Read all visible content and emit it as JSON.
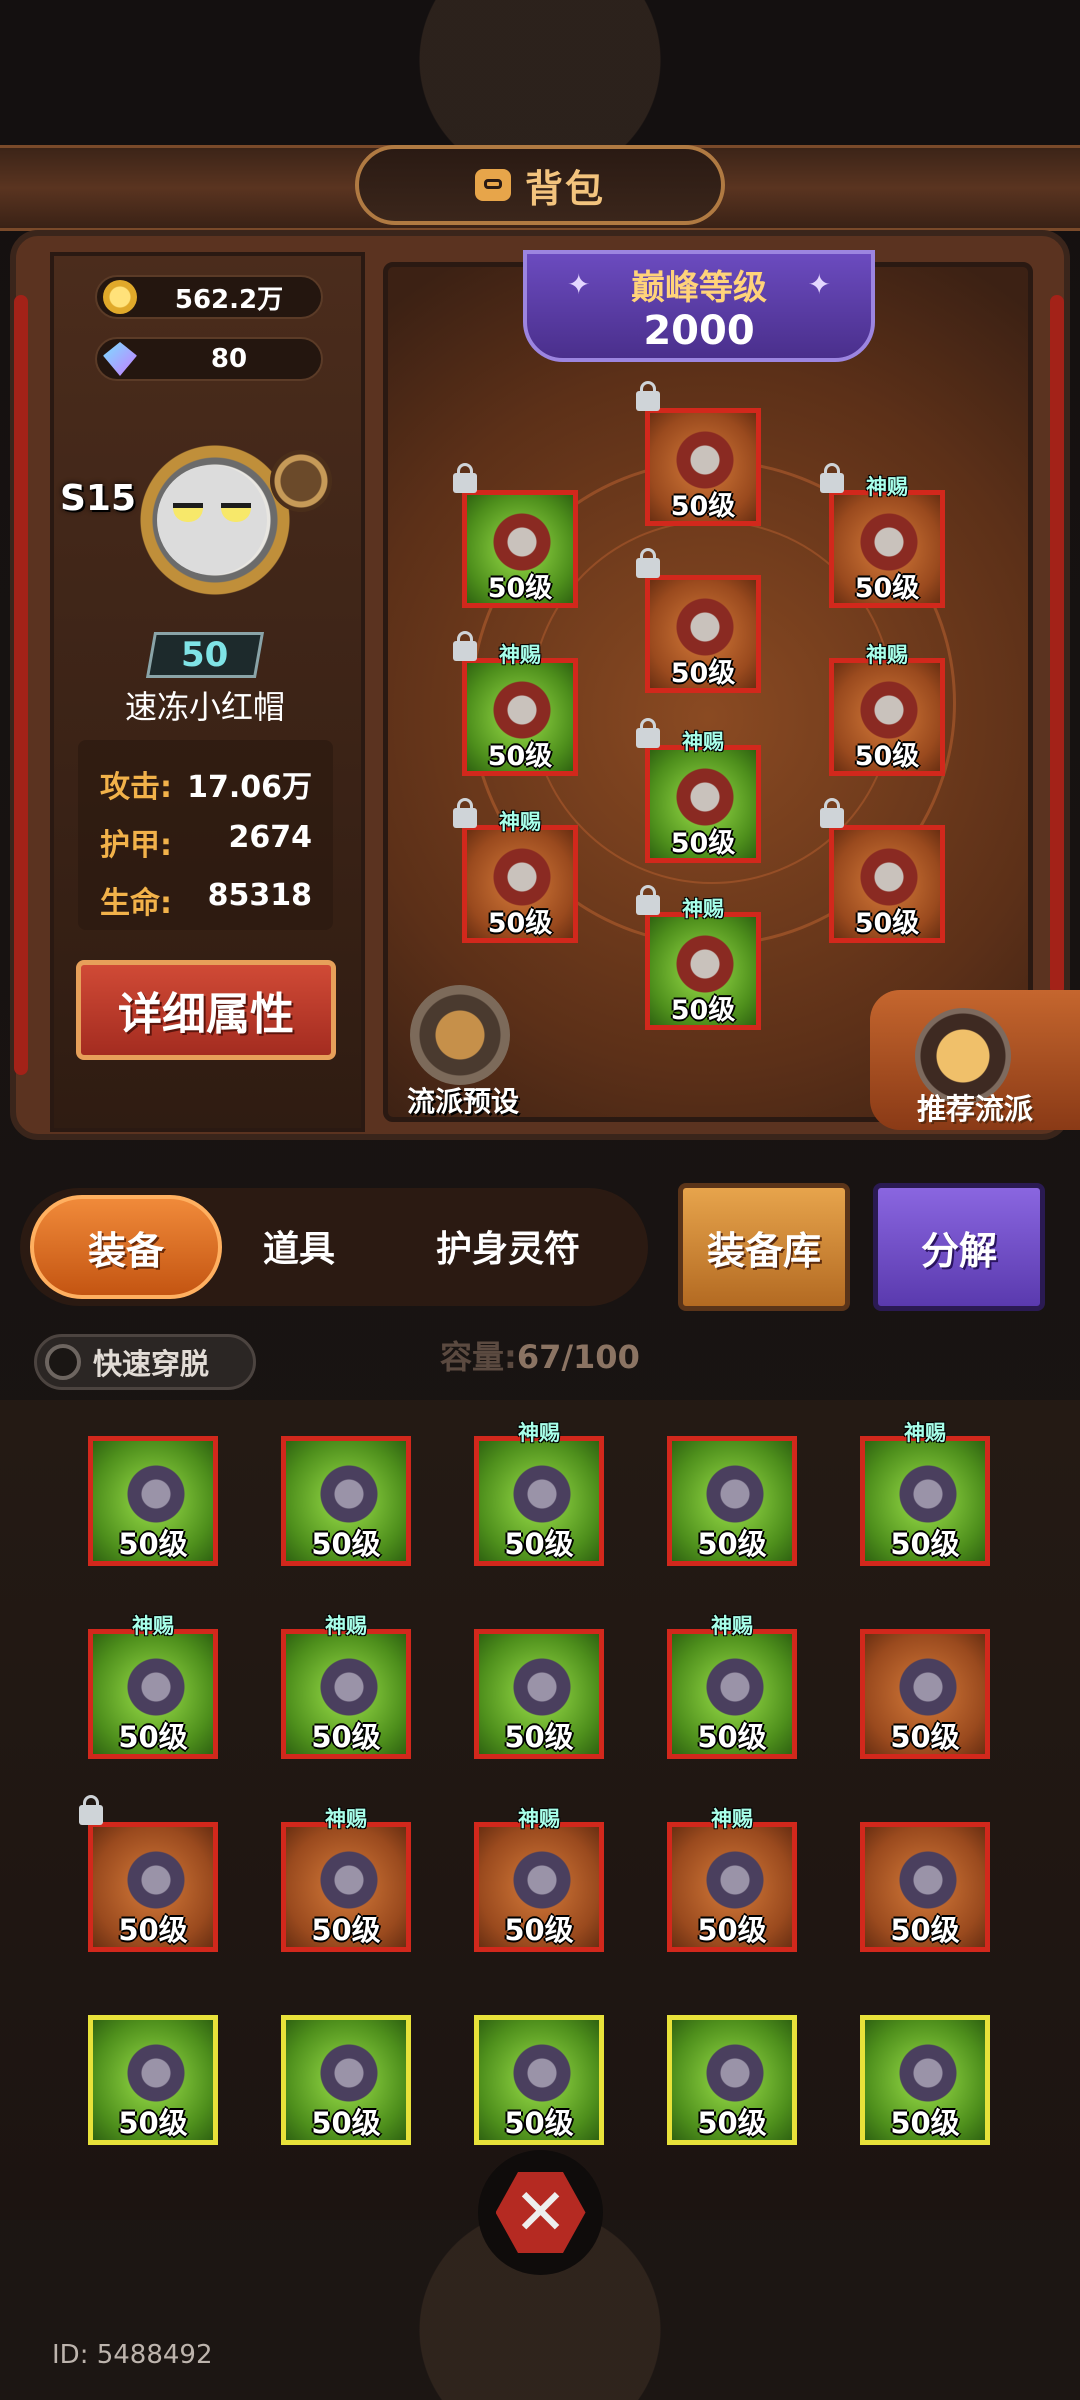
{
  "header": {
    "title": "背包"
  },
  "currencies": [
    {
      "icon": "gold-coin-icon",
      "value": "562.2万"
    },
    {
      "icon": "gem-icon",
      "value": "80"
    }
  ],
  "hero": {
    "season": "S15",
    "level": "50",
    "name": "速冻小红帽",
    "stats": [
      {
        "label": "攻击:",
        "value": "17.06万"
      },
      {
        "label": "护甲:",
        "value": "2674"
      },
      {
        "label": "生命:",
        "value": "85318"
      }
    ],
    "detail_button": "详细属性"
  },
  "peak": {
    "label": "巅峰等级",
    "value": "2000"
  },
  "equipped": [
    {
      "level": "50级",
      "locked": true,
      "tag": "",
      "color": "orange",
      "icon": "helmet-icon"
    },
    {
      "level": "50级",
      "locked": true,
      "tag": "",
      "color": "green",
      "icon": "shoulder-armor-icon"
    },
    {
      "level": "50级",
      "locked": true,
      "tag": "神赐",
      "color": "orange",
      "icon": "necklace-icon"
    },
    {
      "level": "50级",
      "locked": true,
      "tag": "",
      "color": "orange",
      "icon": "chest-armor-icon"
    },
    {
      "level": "50级",
      "locked": true,
      "tag": "神赐",
      "color": "green",
      "icon": "gauntlet-icon"
    },
    {
      "level": "50级",
      "locked": false,
      "tag": "神赐",
      "color": "orange",
      "icon": "ring-icon"
    },
    {
      "level": "50级",
      "locked": true,
      "tag": "神赐",
      "color": "green",
      "icon": "pants-icon"
    },
    {
      "level": "50级",
      "locked": true,
      "tag": "神赐",
      "color": "orange",
      "icon": "cape-icon"
    },
    {
      "level": "50级",
      "locked": true,
      "tag": "",
      "color": "orange",
      "icon": "book-icon"
    },
    {
      "level": "50级",
      "locked": true,
      "tag": "神赐",
      "color": "green",
      "icon": "boots-icon"
    }
  ],
  "preset": {
    "label": "流派预设"
  },
  "recommend": {
    "label": "推荐流派"
  },
  "tabs": {
    "equip": "装备",
    "items": "道具",
    "charm": "护身灵符"
  },
  "buttons": {
    "vault": "装备库",
    "decompose": "分解"
  },
  "quick_toggle": "快速穿脱",
  "capacity": {
    "label": "容量:",
    "value": "67/100"
  },
  "inventory": [
    {
      "level": "50级",
      "tag": "",
      "color": "green",
      "locked": false,
      "icon": "robe-icon"
    },
    {
      "level": "50级",
      "tag": "",
      "color": "green",
      "locked": false,
      "icon": "robe-icon"
    },
    {
      "level": "50级",
      "tag": "神赐",
      "color": "green",
      "locked": false,
      "icon": "bracer-icon"
    },
    {
      "level": "50级",
      "tag": "",
      "color": "green",
      "locked": false,
      "icon": "hat-icon"
    },
    {
      "level": "50级",
      "tag": "神赐",
      "color": "green",
      "locked": false,
      "icon": "gauntlet-icon"
    },
    {
      "level": "50级",
      "tag": "神赐",
      "color": "green",
      "locked": false,
      "icon": "pants-icon"
    },
    {
      "level": "50级",
      "tag": "神赐",
      "color": "green",
      "locked": false,
      "icon": "boots-icon"
    },
    {
      "level": "50级",
      "tag": "",
      "color": "green",
      "locked": false,
      "icon": "boots-icon"
    },
    {
      "level": "50级",
      "tag": "神赐",
      "color": "green",
      "locked": false,
      "icon": "helmet-icon"
    },
    {
      "level": "50级",
      "tag": "",
      "color": "orange",
      "locked": false,
      "icon": "claw-icon"
    },
    {
      "level": "50级",
      "tag": "",
      "color": "orange",
      "locked": true,
      "icon": "cape-icon"
    },
    {
      "level": "50级",
      "tag": "神赐",
      "color": "orange",
      "locked": false,
      "icon": "bracer-icon"
    },
    {
      "level": "50级",
      "tag": "神赐",
      "color": "orange",
      "locked": false,
      "icon": "pants-icon"
    },
    {
      "level": "50级",
      "tag": "神赐",
      "color": "orange",
      "locked": false,
      "icon": "pants-icon"
    },
    {
      "level": "50级",
      "tag": "",
      "color": "orange",
      "locked": false,
      "icon": "pants-icon"
    },
    {
      "level": "50级",
      "tag": "",
      "color": "green",
      "locked": false,
      "icon": "chest-armor-icon",
      "yellow": true
    },
    {
      "level": "50级",
      "tag": "",
      "color": "green",
      "locked": false,
      "icon": "hat-icon",
      "yellow": true
    },
    {
      "level": "50级",
      "tag": "",
      "color": "green",
      "locked": false,
      "icon": "hat-icon",
      "yellow": true
    },
    {
      "level": "50级",
      "tag": "",
      "color": "green",
      "locked": false,
      "icon": "shoulder-armor-icon",
      "yellow": true
    },
    {
      "level": "50级",
      "tag": "",
      "color": "green",
      "locked": false,
      "icon": "pants-icon",
      "yellow": true
    }
  ],
  "player_id": "ID: 5488492"
}
